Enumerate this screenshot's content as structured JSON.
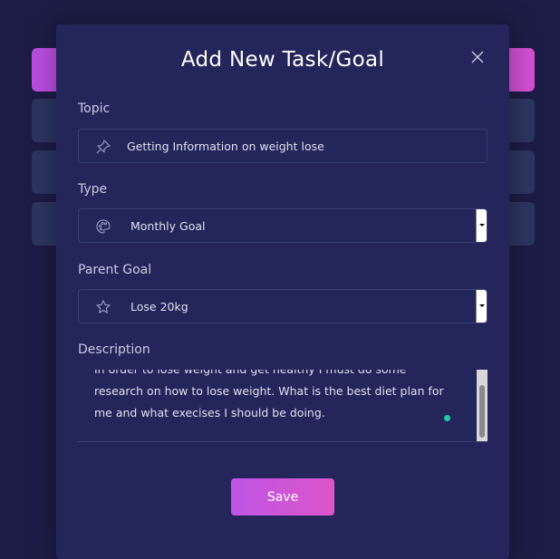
{
  "modal": {
    "title": "Add New Task/Goal",
    "close_icon": "close-icon"
  },
  "form": {
    "topic": {
      "label": "Topic",
      "value": "Getting Information on weight lose",
      "icon": "pin-icon"
    },
    "type": {
      "label": "Type",
      "value": "Monthly Goal",
      "icon": "palette-icon"
    },
    "parent_goal": {
      "label": "Parent Goal",
      "value": "Lose 20kg",
      "icon": "star-icon"
    },
    "description": {
      "label": "Description",
      "value": "In order to lose weight and get healthy I must do some research on how to lose weight. What is the best diet plan for me and what execises I should be doing."
    }
  },
  "actions": {
    "save_label": "Save"
  },
  "colors": {
    "accent_gradient_start": "#bd55e6",
    "accent_gradient_end": "#dd55c8",
    "modal_bg": "#24255a",
    "page_bg": "#1c1c46",
    "status_dot": "#20c9a0"
  }
}
